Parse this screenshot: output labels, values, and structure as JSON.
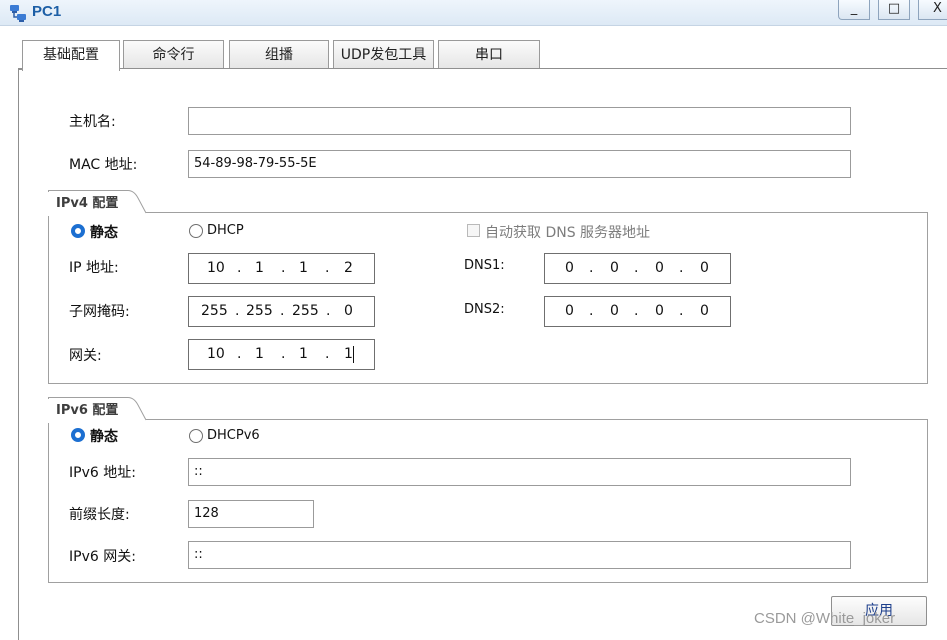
{
  "window": {
    "title": "PC1",
    "minimize": "_",
    "maximize": "□",
    "close": "X"
  },
  "tabs": [
    "基础配置",
    "命令行",
    "组播",
    "UDP发包工具",
    "串口"
  ],
  "basic": {
    "hostname_label": "主机名:",
    "hostname_value": "",
    "mac_label": "MAC 地址:",
    "mac_value": "54-89-98-79-55-5E"
  },
  "ipv4": {
    "section_title": "IPv4 配置",
    "static_label": "静态",
    "dhcp_label": "DHCP",
    "auto_dns_label": "自动获取 DNS 服务器地址",
    "ip_label": "IP 地址:",
    "ip_octets": [
      "10",
      "1",
      "1",
      "2"
    ],
    "mask_label": "子网掩码:",
    "mask_octets": [
      "255",
      "255",
      "255",
      "0"
    ],
    "gateway_label": "网关:",
    "gateway_octets": [
      "10",
      "1",
      "1",
      "1"
    ],
    "dns1_label": "DNS1:",
    "dns1_octets": [
      "0",
      "0",
      "0",
      "0"
    ],
    "dns2_label": "DNS2:",
    "dns2_octets": [
      "0",
      "0",
      "0",
      "0"
    ],
    "separator": "."
  },
  "ipv6": {
    "section_title": "IPv6 配置",
    "static_label": "静态",
    "dhcp_label": "DHCPv6",
    "addr_label": "IPv6 地址:",
    "addr_value": "::",
    "prefix_label": "前缀长度:",
    "prefix_value": "128",
    "gateway_label": "IPv6 网关:",
    "gateway_value": "::"
  },
  "apply_button": "应用",
  "watermark": "CSDN @White_joker",
  "colors": {
    "accent": "#1c6fd1",
    "title_text": "#1d5fa6"
  }
}
